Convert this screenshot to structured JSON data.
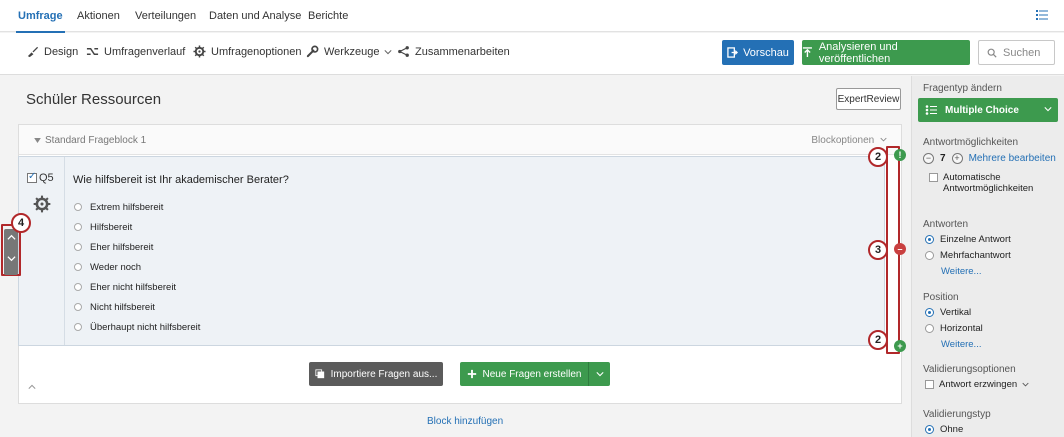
{
  "nav": {
    "tabs": [
      "Umfrage",
      "Aktionen",
      "Verteilungen",
      "Daten und Analyse",
      "Berichte"
    ],
    "active_tab": "Umfrage"
  },
  "toolbar": {
    "design": "Design",
    "flow": "Umfragenverlauf",
    "options": "Umfragenoptionen",
    "tools": "Werkzeuge",
    "collaborate": "Zusammenarbeiten",
    "preview": "Vorschau",
    "publish": "Analysieren und veröffentlichen",
    "search_placeholder": "Suchen"
  },
  "survey": {
    "title": "Schüler Ressourcen",
    "expert_review": "ExpertReview",
    "block_name": "Standard Frageblock 1",
    "block_options": "Blockoptionen",
    "question_id": "Q5",
    "question_text": "Wie hilfsbereit ist Ihr akademischer Berater?",
    "choices": [
      "Extrem hilfsbereit",
      "Hilfsbereit",
      "Eher hilfsbereit",
      "Weder noch",
      "Eher nicht hilfsbereit",
      "Nicht hilfsbereit",
      "Überhaupt nicht hilfsbereit"
    ],
    "import_button": "Importiere Fragen aus...",
    "new_question_button": "Neue Fragen erstellen",
    "add_block": "Block hinzufügen"
  },
  "callouts": {
    "top": "2",
    "middle": "3",
    "bottom": "2",
    "left": "4"
  },
  "panel": {
    "type_label": "Fragentyp ändern",
    "type_value": "Multiple Choice",
    "choices_label": "Antwortmöglichkeiten",
    "choices_count": "7",
    "edit_multiple": "Mehrere bearbeiten",
    "auto_choices_line1": "Automatische",
    "auto_choices_line2": "Antwortmöglichkeiten",
    "answers_label": "Antworten",
    "single_answer": "Einzelne Antwort",
    "multiple_answer": "Mehrfachantwort",
    "more1": "Weitere...",
    "position_label": "Position",
    "vertical": "Vertikal",
    "horizontal": "Horizontal",
    "more2": "Weitere...",
    "validation_label": "Validierungsoptionen",
    "force_response": "Antwort erzwingen",
    "validation_type_label": "Validierungstyp",
    "none": "Ohne"
  },
  "colors": {
    "accent_blue": "#2470b5",
    "green": "#3d9a4e",
    "callout_red": "#b1282a",
    "remove_red": "#c94040"
  }
}
